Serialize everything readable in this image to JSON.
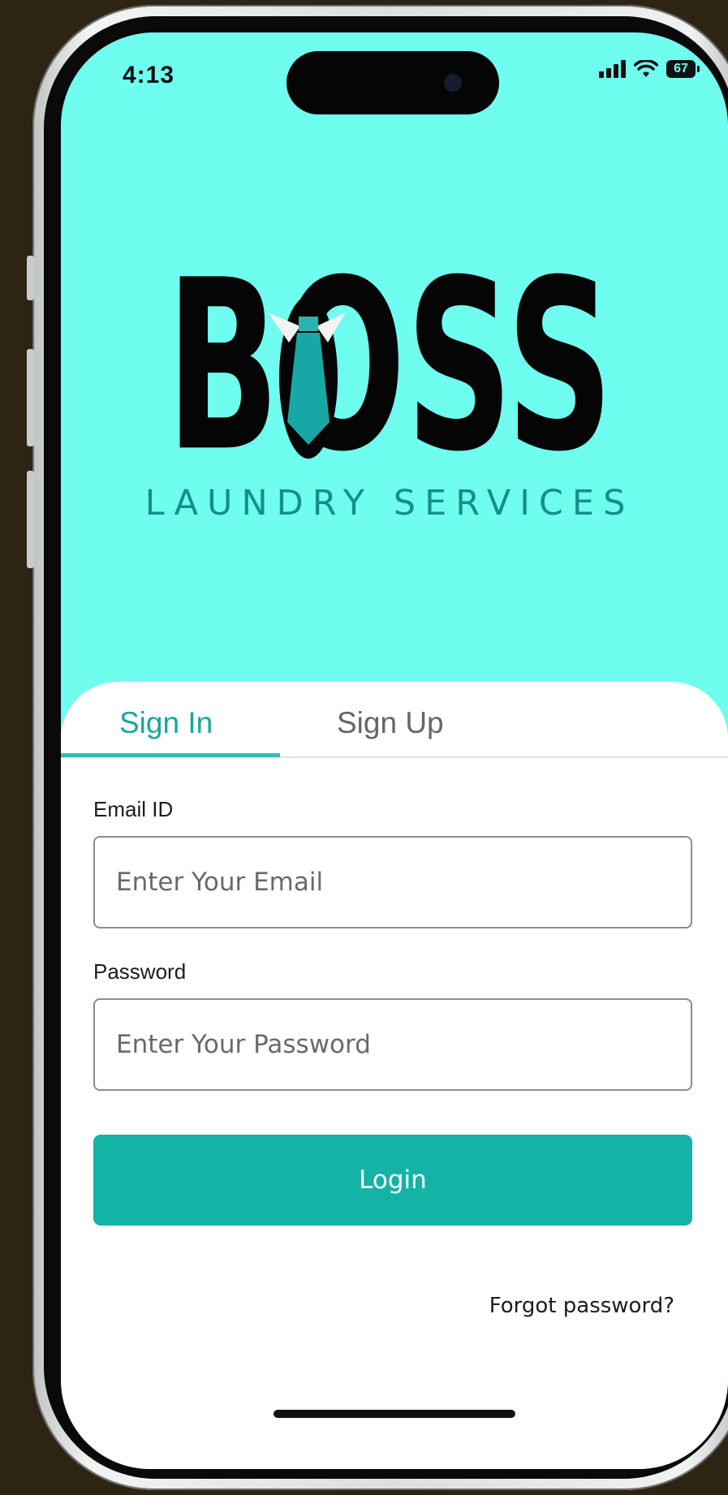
{
  "status_bar": {
    "time": "4:13",
    "battery": "67",
    "icons": [
      "signal-icon",
      "wifi-icon",
      "battery-icon"
    ]
  },
  "brand": {
    "name": "BOSS",
    "tagline": "LAUNDRY SERVICES",
    "colors": {
      "accent": "#14b3a6",
      "background": "#6ffdf0",
      "tie": "#17a7a5"
    }
  },
  "tabs": [
    {
      "label": "Sign In",
      "active": true
    },
    {
      "label": "Sign Up",
      "active": false
    }
  ],
  "form": {
    "email_label": "Email ID",
    "email_placeholder": "Enter Your Email",
    "password_label": "Password",
    "password_placeholder": "Enter Your Password",
    "login_label": "Login",
    "forgot_label": "Forgot password?"
  }
}
